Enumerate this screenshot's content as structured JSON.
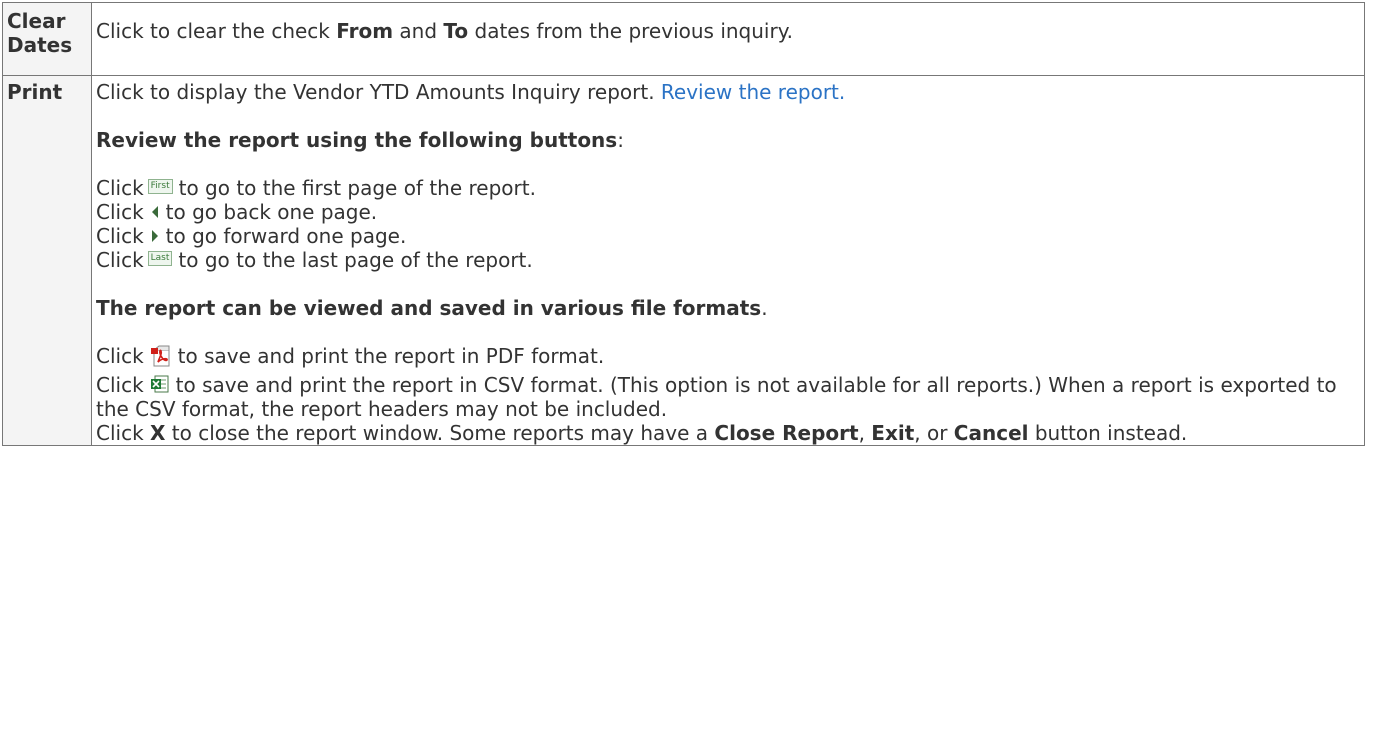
{
  "rows": {
    "clear_dates": {
      "label_line1": "Clear",
      "label_line2": "Dates",
      "text_1": "Click to clear the check ",
      "bold_from": "From",
      "text_2": " and ",
      "bold_to": "To",
      "text_3": " dates from the previous inquiry."
    },
    "print": {
      "label": "Print",
      "intro": "Click to display the Vendor YTD Amounts Inquiry report. ",
      "review_link": "Review the report.",
      "buttons_heading": "Review the report using the following buttons",
      "buttons_heading_colon": ":",
      "nav": {
        "click": "Click",
        "first_btn": "First",
        "first_text": "to go to the first page of the report.",
        "back_text": "to go back one page.",
        "forward_text": "to go forward one page.",
        "last_btn": "Last",
        "last_text": "to go to the last page of the report."
      },
      "formats_heading": "The report can be viewed and saved in various file formats",
      "formats_heading_period": ".",
      "pdf_text": "to save and print the report in PDF format.",
      "csv_text": "to save and print the report in CSV format. (This option is not available for all reports.) When a report is exported to the CSV format, the report headers may not be included.",
      "close_1": "Click ",
      "close_x": "X",
      "close_2": " to close the report window. Some reports may have a ",
      "close_report": "Close Report",
      "close_3": ", ",
      "close_exit": "Exit",
      "close_4": ", or ",
      "close_cancel": "Cancel",
      "close_5": " button instead."
    }
  },
  "colors": {
    "link": "#2b73c5",
    "text": "#333333",
    "border": "#777777"
  },
  "icons": [
    "first-button-icon",
    "back-arrow-icon",
    "forward-arrow-icon",
    "last-button-icon",
    "pdf-icon",
    "csv-excel-icon"
  ]
}
